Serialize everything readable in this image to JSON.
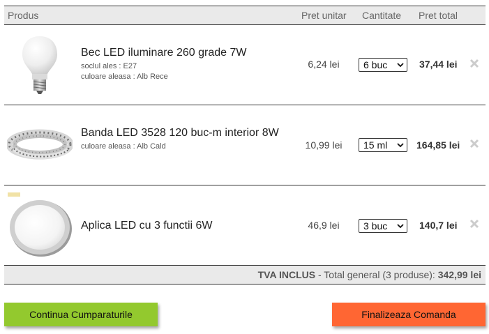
{
  "header": {
    "product": "Produs",
    "unit_price": "Pret unitar",
    "quantity": "Cantitate",
    "total_price": "Pret total"
  },
  "items": [
    {
      "name": "Bec LED iluminare 260 grade 7W",
      "attrs": [
        "soclul ales : E27",
        "culoare aleasa : Alb Rece"
      ],
      "unit_price": "6,24 lei",
      "quantity": "6 buc",
      "total": "37,44 lei",
      "icon": "led-bulb-image"
    },
    {
      "name": "Banda LED 3528 120 buc-m interior 8W",
      "attrs": [
        "culoare aleasa : Alb Cald"
      ],
      "unit_price": "10,99 lei",
      "quantity": "15 ml",
      "total": "164,85 lei",
      "icon": "led-strip-image"
    },
    {
      "name": "Aplica LED cu 3 functii 6W",
      "attrs": [],
      "unit_price": "46,9 lei",
      "quantity": "3 buc",
      "total": "140,7 lei",
      "icon": "round-ceiling-light-image"
    }
  ],
  "summary": {
    "vat": "TVA INCLUS",
    "separator": " - ",
    "label": "Total general (3 produse): ",
    "amount": "342,99 lei"
  },
  "buttons": {
    "continue": "Continua Cumparaturile",
    "finalize": "Finalizeaza Comanda"
  },
  "colors": {
    "continue_bg": "#93c92e",
    "finalize_bg": "#ff6633",
    "header_bg": "#eaeaea"
  }
}
